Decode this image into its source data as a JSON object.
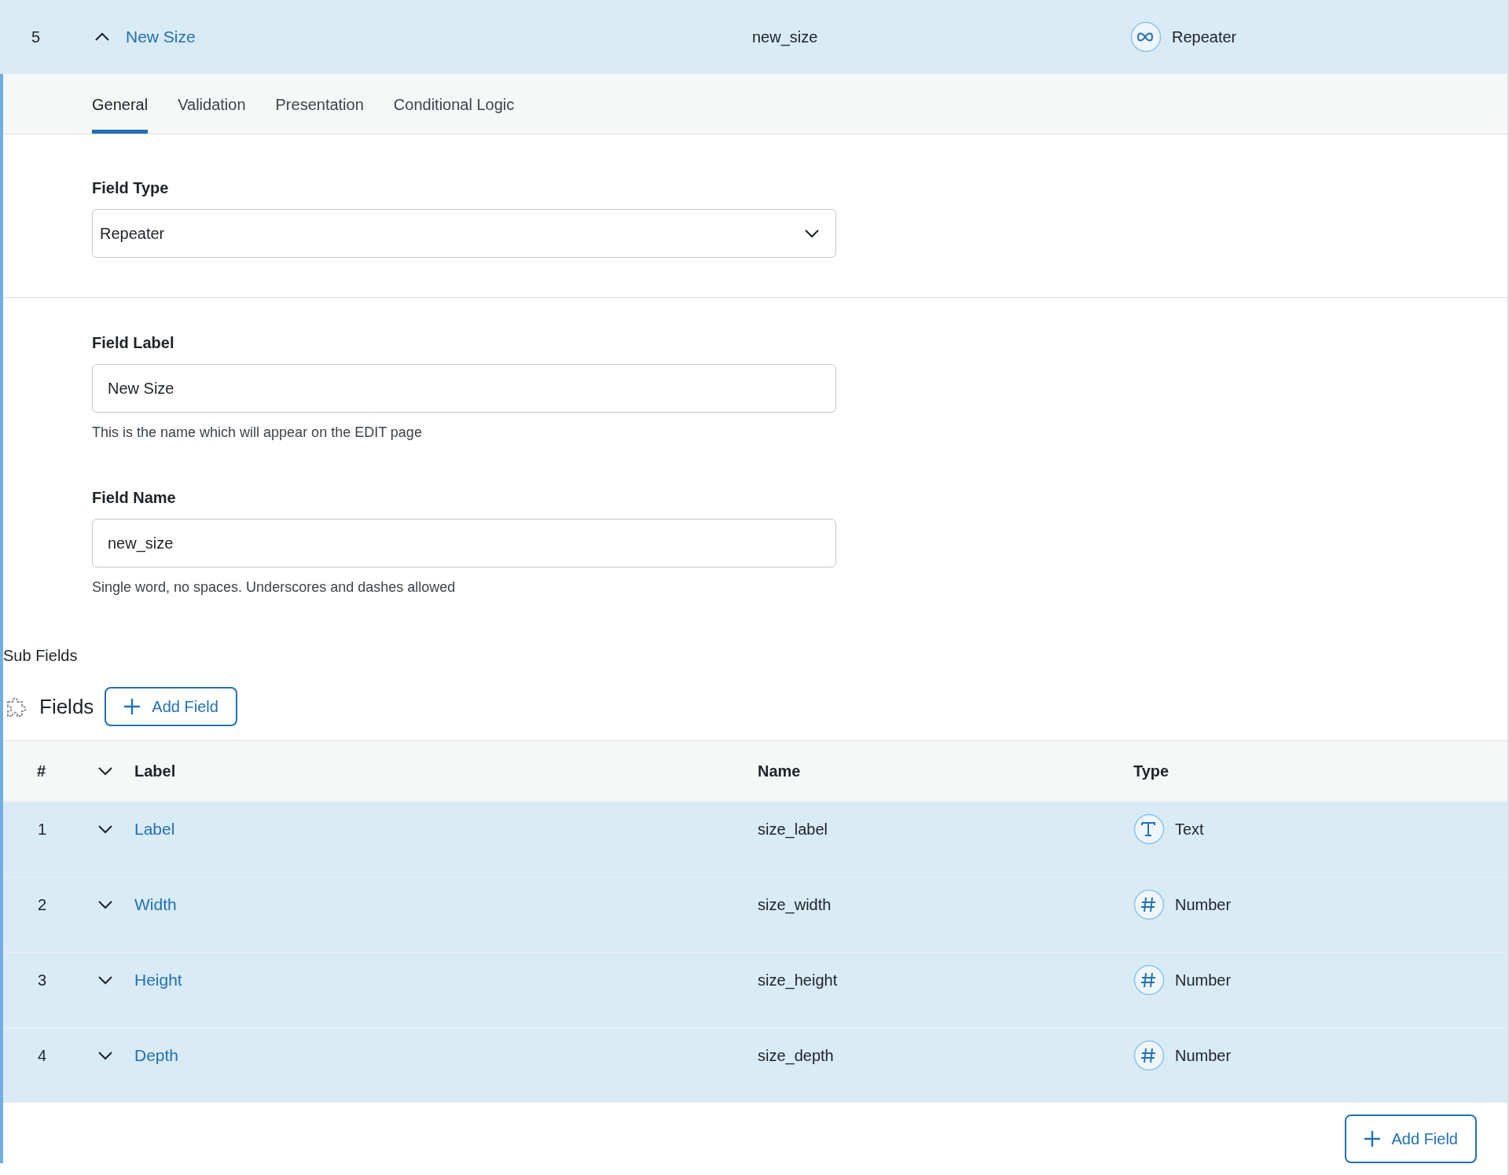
{
  "field": {
    "number": "5",
    "expanded": true,
    "label": "New Size",
    "name": "new_size",
    "type": "Repeater",
    "kind": "repeater"
  },
  "tabs": [
    {
      "label": "General",
      "selected": true
    },
    {
      "label": "Validation",
      "selected": false
    },
    {
      "label": "Presentation",
      "selected": false
    },
    {
      "label": "Conditional Logic",
      "selected": false
    }
  ],
  "settings": {
    "field_type": {
      "label": "Field Type",
      "value": "Repeater"
    },
    "field_label": {
      "label": "Field Label",
      "value": "New Size",
      "help": "This is the name which will appear on the EDIT page"
    },
    "field_name": {
      "label": "Field Name",
      "value": "new_size",
      "help": "Single word, no spaces. Underscores and dashes allowed"
    }
  },
  "sub_fields": {
    "title": "Sub Fields",
    "heading": "Fields",
    "add_button": "Add Field",
    "columns": [
      "#",
      "Label",
      "Name",
      "Type"
    ],
    "rows": [
      {
        "number": "1",
        "label": "Label",
        "name": "size_label",
        "type": "Text",
        "kind": "text",
        "expanded": false
      },
      {
        "number": "2",
        "label": "Width",
        "name": "size_width",
        "type": "Number",
        "kind": "number",
        "expanded": false
      },
      {
        "number": "3",
        "label": "Height",
        "name": "size_height",
        "type": "Number",
        "kind": "number",
        "expanded": false
      },
      {
        "number": "4",
        "label": "Depth",
        "name": "size_depth",
        "type": "Number",
        "kind": "number",
        "expanded": false
      }
    ],
    "footer_button": "Add Field"
  }
}
